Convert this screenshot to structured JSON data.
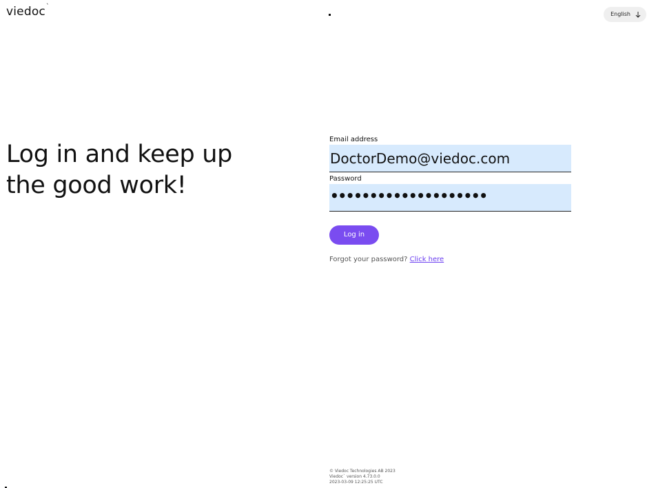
{
  "header": {
    "logo_text": "viedoc",
    "logo_mark": "`",
    "language": {
      "label": "English",
      "icon": "arrow-down-icon"
    }
  },
  "hero": {
    "line1": "Log in and keep up",
    "line2": "the good work!"
  },
  "form": {
    "email": {
      "label": "Email address",
      "value": "DoctorDemo@viedoc.com"
    },
    "password": {
      "label": "Password",
      "masked_value": "••••••••••••••••••••"
    },
    "login_label": "Log in",
    "forgot_prefix": "Forgot your password?",
    "forgot_link": "Click here"
  },
  "footer": {
    "copyright": "© Viedoc Technologies AB 2023",
    "version": "Viedoc` version 4.73.0.0",
    "timestamp": "2023-03-09 12:25:25 UTC"
  },
  "colors": {
    "accent": "#7a4cf0",
    "link": "#6a3df0",
    "input_bg": "#d7eafd",
    "lang_bg": "#efefef"
  }
}
